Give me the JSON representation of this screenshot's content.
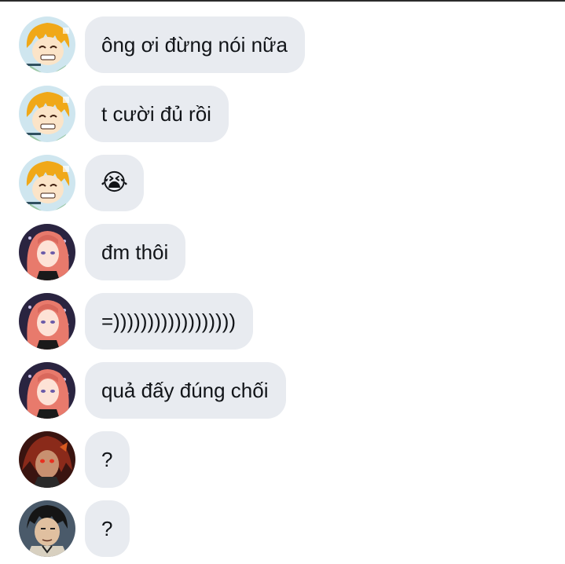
{
  "messages": [
    {
      "avatar": "zenitsu-avatar",
      "text": "ông ơi đừng nói nữa"
    },
    {
      "avatar": "zenitsu-avatar",
      "text": "t cười đủ rồi"
    },
    {
      "avatar": "zenitsu-avatar",
      "text": "😭"
    },
    {
      "avatar": "pink-hair-avatar",
      "text": "đm thôi"
    },
    {
      "avatar": "pink-hair-avatar",
      "text": "=))))))))))))))))))"
    },
    {
      "avatar": "pink-hair-avatar",
      "text": "quả đấy đúng chối"
    },
    {
      "avatar": "red-eyes-avatar",
      "text": "?"
    },
    {
      "avatar": "dark-hair-avatar",
      "text": "?"
    }
  ],
  "colors": {
    "bubble": "#e8ebf0",
    "text": "#111418",
    "background": "#ffffff"
  }
}
